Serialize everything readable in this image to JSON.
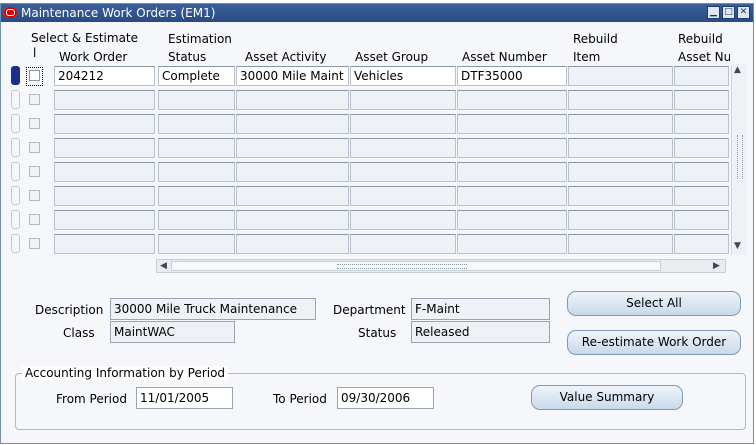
{
  "window": {
    "title": "Maintenance Work Orders (EM1)"
  },
  "table": {
    "headers": {
      "select_line1": "Select & Estimate",
      "select_line2": "l",
      "work_order": "Work Order",
      "estimation_line1": "Estimation",
      "estimation_line2": "Status",
      "asset_activity": "Asset Activity",
      "asset_group": "Asset Group",
      "asset_number": "Asset Number",
      "rebuild_item_line1": "Rebuild",
      "rebuild_item_line2": "Item",
      "rebuild_asset_line1": "Rebuild",
      "rebuild_asset_line2": "Asset Nu"
    },
    "rows": [
      {
        "work_order": "204212",
        "estimation_status": "Complete",
        "asset_activity": "30000 Mile Maint",
        "asset_group": "Vehicles",
        "asset_number": "DTF35000",
        "rebuild_item": "",
        "rebuild_asset": ""
      }
    ]
  },
  "details": {
    "description_label": "Description",
    "description_value": "30000 Mile Truck Maintenance",
    "class_label": "Class",
    "class_value": "MaintWAC",
    "department_label": "Department",
    "department_value": "F-Maint",
    "status_label": "Status",
    "status_value": "Released"
  },
  "buttons": {
    "select_all": "Select All",
    "reestimate": "Re-estimate Work Order",
    "value_summary": "Value Summary"
  },
  "accounting": {
    "group_label": "Accounting Information by Period",
    "from_label": "From Period",
    "from_value": "11/01/2005",
    "to_label": "To Period",
    "to_value": "09/30/2006"
  }
}
